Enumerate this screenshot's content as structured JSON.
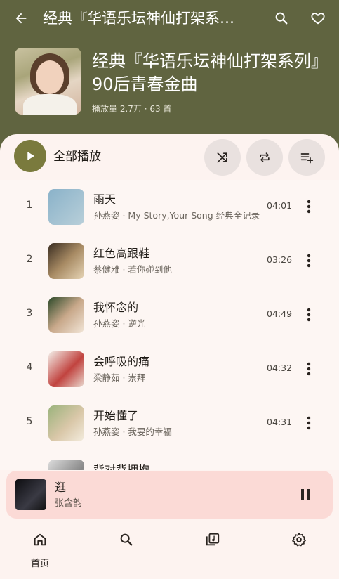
{
  "topbar": {
    "title": "经典『华语乐坛神仙打架系…",
    "back_icon": "arrow-back-icon",
    "search_icon": "search-icon",
    "favorite_icon": "heart-outline-icon"
  },
  "playlist": {
    "title": "经典『华语乐坛神仙打架系列』90后青春金曲",
    "meta": "播放量 2.7万 · 63 首"
  },
  "controls": {
    "play_all_label": "全部播放",
    "icons": [
      "play-icon",
      "shuffle-icon",
      "repeat-icon",
      "add-to-queue-icon"
    ]
  },
  "songs": [
    {
      "index": "1",
      "title": "雨天",
      "subtitle": "孙燕姿 · My Story,Your Song 经典全记录",
      "duration": "04:01"
    },
    {
      "index": "2",
      "title": "红色高跟鞋",
      "subtitle": "蔡健雅 · 若你碰到他",
      "duration": "03:26"
    },
    {
      "index": "3",
      "title": "我怀念的",
      "subtitle": "孙燕姿 · 逆光",
      "duration": "04:49"
    },
    {
      "index": "4",
      "title": "会呼吸的痛",
      "subtitle": "梁静茹 · 崇拜",
      "duration": "04:32"
    },
    {
      "index": "5",
      "title": "开始懂了",
      "subtitle": "孙燕姿 · 我要的幸福",
      "duration": "04:31"
    },
    {
      "index": "",
      "title": "背对背拥抱",
      "subtitle": "",
      "duration": ""
    }
  ],
  "now_playing": {
    "title": "逛",
    "artist": "张含韵",
    "pause_icon": "pause-icon"
  },
  "bottom_nav": {
    "home_label": "首页",
    "icons": [
      "home-icon",
      "search-icon",
      "library-music-icon",
      "settings-gear-icon"
    ]
  },
  "colors": {
    "header_bg": "#606440",
    "accent": "#7a7a3d",
    "sheet_bg": "#fdf3f0",
    "mini_player_bg": "#fbdad6"
  }
}
